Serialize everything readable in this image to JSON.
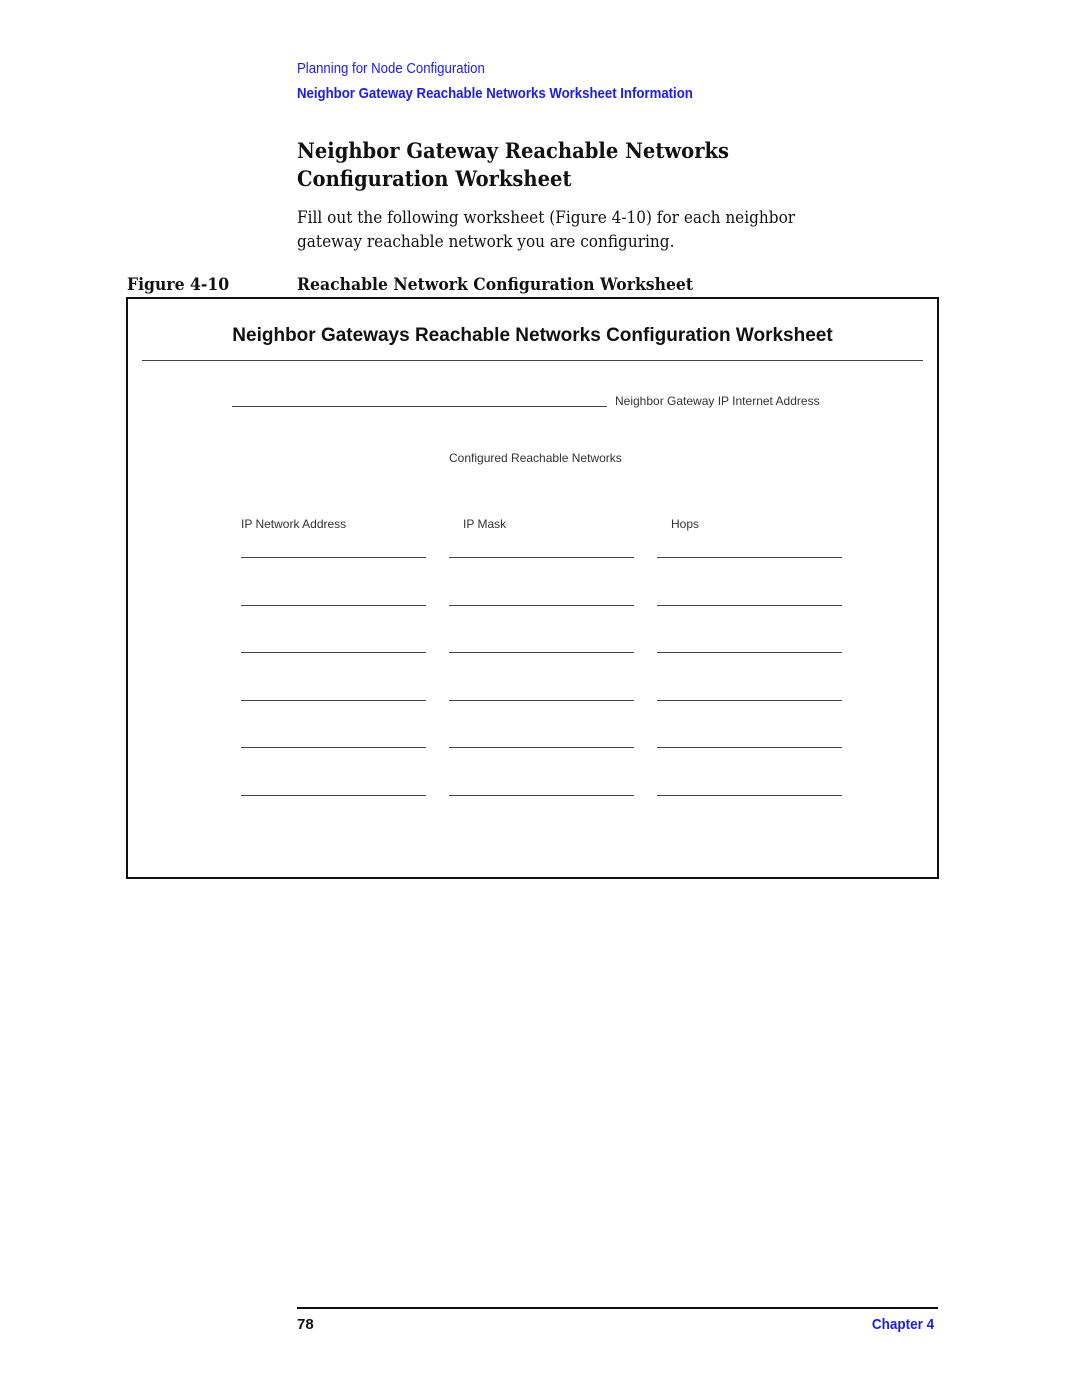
{
  "header": {
    "chapter_title": "Planning for Node Configuration",
    "section_title": "Neighbor Gateway Reachable Networks Worksheet Information"
  },
  "section": {
    "title": "Neighbor Gateway Reachable Networks Configuration Worksheet",
    "body": "Fill out the following worksheet (Figure 4-10) for each neighbor gateway reachable network you are configuring."
  },
  "figure": {
    "number": "Figure 4-10",
    "caption": "Reachable Network Configuration Worksheet"
  },
  "worksheet": {
    "title": "Neighbor Gateways Reachable Networks Configuration Worksheet",
    "gateway_label": "Neighbor Gateway IP Internet Address",
    "gateway_value": "",
    "networks_label": "Configured Reachable Networks",
    "columns": [
      "IP Network Address",
      "IP Mask",
      "Hops"
    ],
    "rows": [
      [
        "",
        "",
        ""
      ],
      [
        "",
        "",
        ""
      ],
      [
        "",
        "",
        ""
      ],
      [
        "",
        "",
        ""
      ],
      [
        "",
        "",
        ""
      ],
      [
        "",
        "",
        ""
      ]
    ]
  },
  "footer": {
    "page_number": "78",
    "chapter": "Chapter 4"
  }
}
